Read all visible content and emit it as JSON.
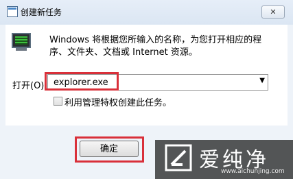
{
  "window": {
    "title": "创建新任务",
    "close_label": "✕"
  },
  "dialog": {
    "description": "Windows 将根据您所输入的名称，为您打开相应的程序、文件夹、文档或 Internet 资源。",
    "open_label": "打开(O):",
    "open_value": "explorer.exe",
    "checkbox_label": "利用管理特权创建此任务。",
    "checkbox_checked": false,
    "ok_label": "确定"
  },
  "watermark": {
    "text": "爱纯净",
    "url": "www.aichunjing.com"
  },
  "colors": {
    "highlight": "#d9303a",
    "title_bar": "#dbe6f3"
  },
  "icons": {
    "title": "task-icon",
    "run": "run-computer-icon",
    "dropdown": "chevron-down-icon"
  }
}
